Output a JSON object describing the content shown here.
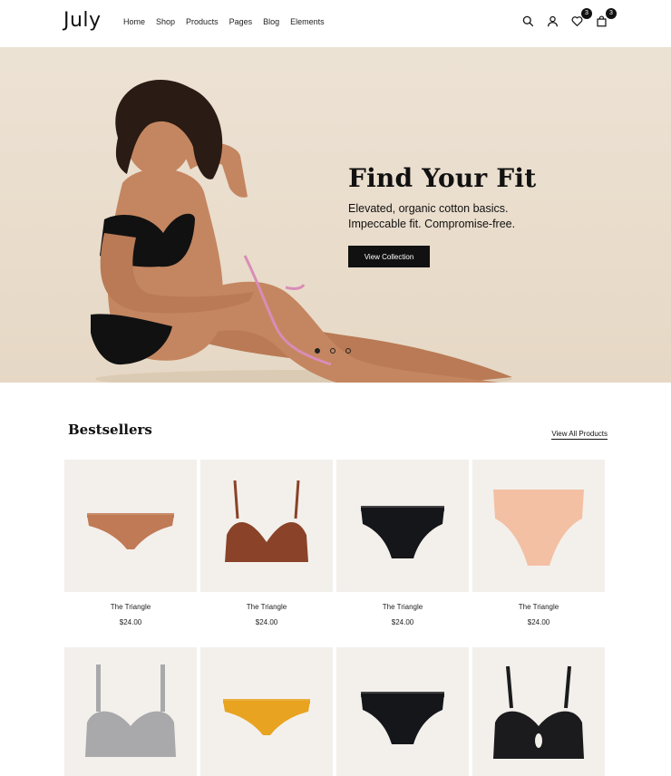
{
  "header": {
    "logo": "July",
    "nav": [
      "Home",
      "Shop",
      "Products",
      "Pages",
      "Blog",
      "Elements"
    ],
    "wishlist_count": "3",
    "cart_count": "3",
    "icons": [
      "search-icon",
      "user-icon",
      "heart-icon",
      "bag-icon"
    ]
  },
  "hero": {
    "title": "Find Your Fit",
    "subtitle_line1": "Elevated, organic cotton basics.",
    "subtitle_line2": "Impeccable fit. Compromise-free.",
    "button": "View Collection",
    "slides": 3,
    "active_slide": 1
  },
  "bestsellers": {
    "title": "Bestsellers",
    "view_all": "View All Products",
    "products": [
      {
        "name": "The Triangle",
        "price": "$24.00",
        "item": "thong",
        "color": "#c07a55"
      },
      {
        "name": "The Triangle",
        "price": "$24.00",
        "item": "bralette",
        "color": "#8a4328"
      },
      {
        "name": "The Triangle",
        "price": "$24.00",
        "item": "brief",
        "color": "#15161a"
      },
      {
        "name": "The Triangle",
        "price": "$24.00",
        "item": "highwaist",
        "color": "#f3c0a4"
      },
      {
        "name": "",
        "price": "",
        "item": "sport-bra",
        "color": "#a9a9ab"
      },
      {
        "name": "",
        "price": "",
        "item": "thong",
        "color": "#e8a320"
      },
      {
        "name": "",
        "price": "",
        "item": "brief",
        "color": "#15161a"
      },
      {
        "name": "",
        "price": "",
        "item": "keyhole-bra",
        "color": "#1b1b1d"
      }
    ]
  }
}
